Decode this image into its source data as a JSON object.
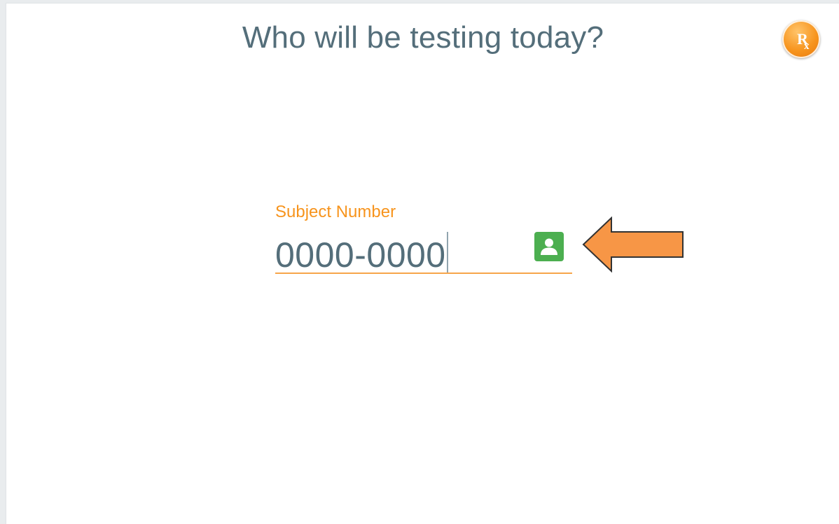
{
  "page": {
    "title": "Who will be testing today?"
  },
  "badge": {
    "icon": "rx-icon",
    "text": "Rx"
  },
  "subject_field": {
    "label": "Subject Number",
    "value": "0000-0000",
    "lookup_icon": "contact-card-icon"
  },
  "annotation": {
    "icon": "pointer-arrow-icon"
  },
  "colors": {
    "title_text": "#546e7a",
    "accent": "#f7941d",
    "lookup_button": "#4caf50",
    "arrow_fill": "#f79646",
    "arrow_stroke": "#333333"
  }
}
